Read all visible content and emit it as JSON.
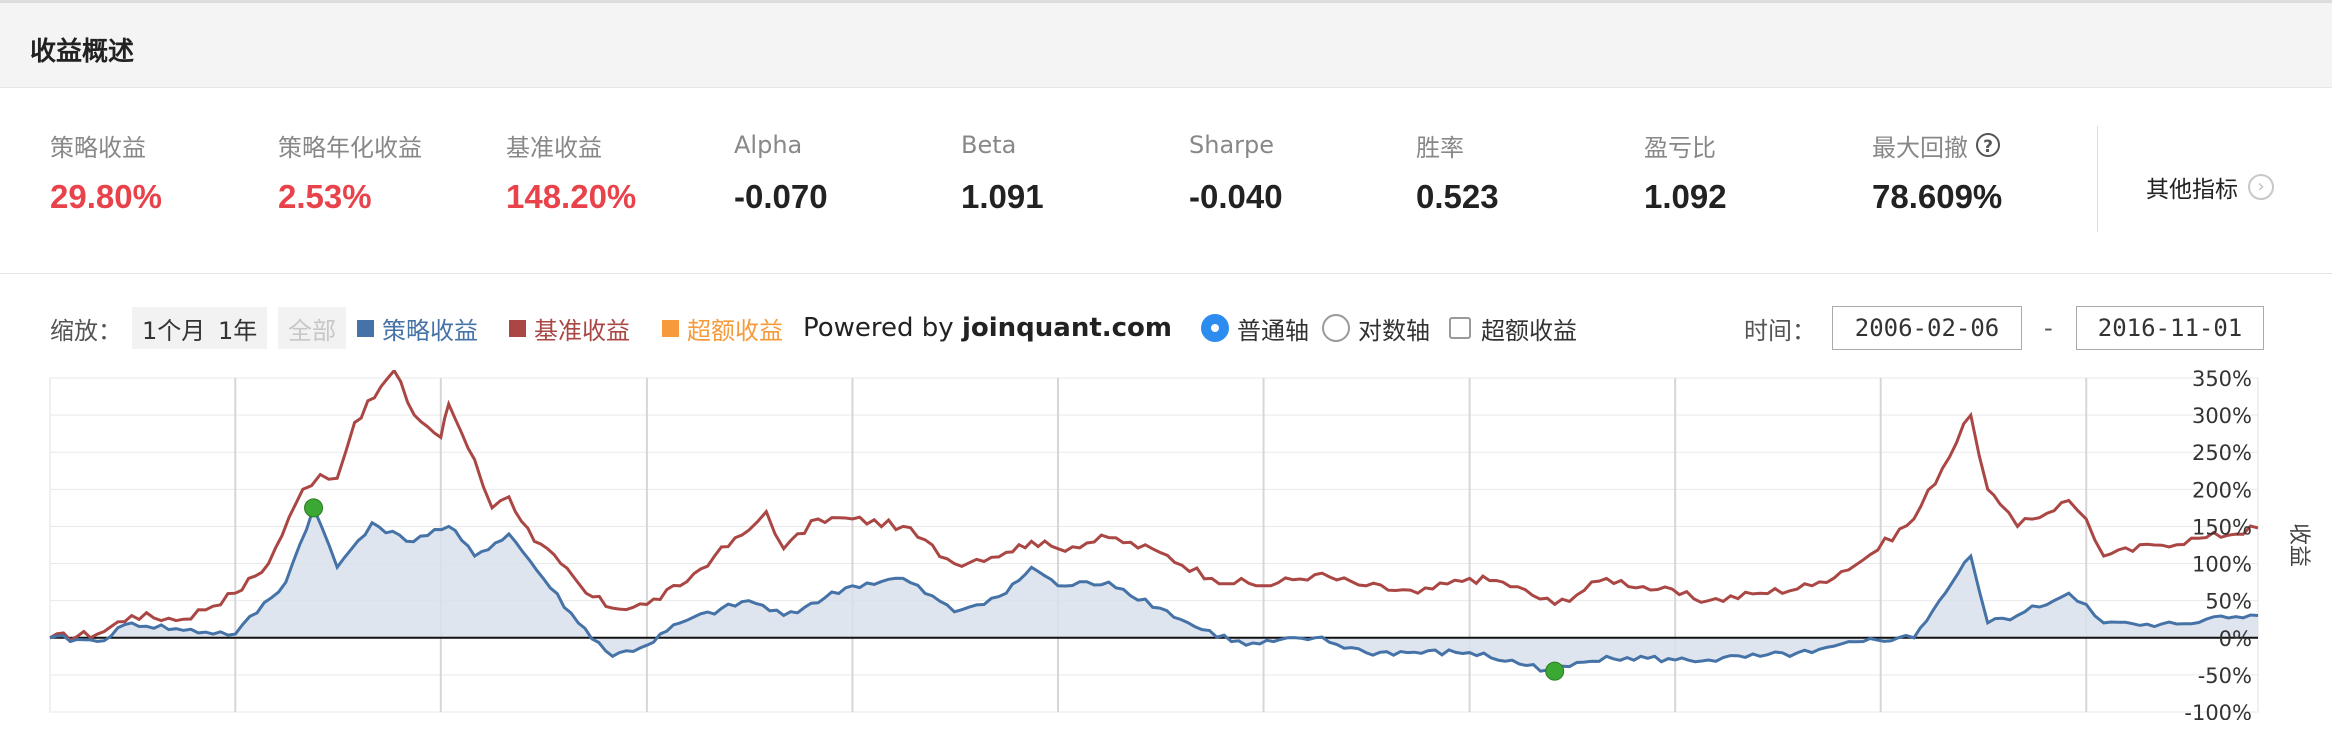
{
  "header": {
    "title": "收益概述"
  },
  "metrics": [
    {
      "label": "策略收益",
      "value": "29.80%",
      "tone": "red"
    },
    {
      "label": "策略年化收益",
      "value": "2.53%",
      "tone": "red"
    },
    {
      "label": "基准收益",
      "value": "148.20%",
      "tone": "red"
    },
    {
      "label": "Alpha",
      "value": "-0.070",
      "tone": "dark"
    },
    {
      "label": "Beta",
      "value": "1.091",
      "tone": "dark"
    },
    {
      "label": "Sharpe",
      "value": "-0.040",
      "tone": "dark"
    },
    {
      "label": "胜率",
      "value": "0.523",
      "tone": "dark"
    },
    {
      "label": "盈亏比",
      "value": "1.092",
      "tone": "dark"
    },
    {
      "label": "最大回撤",
      "value": "78.609%",
      "tone": "dark",
      "help_icon": "question-circle-icon"
    }
  ],
  "other_metrics": {
    "label": "其他指标",
    "icon": "chevron-right-circle-icon"
  },
  "toolbar": {
    "zoom_label": "缩放：",
    "zoom_buttons": [
      "1个月",
      "1年",
      "全部"
    ],
    "legend": [
      {
        "label": "策略收益",
        "color": "#4572a7"
      },
      {
        "label": "基准收益",
        "color": "#aa4643"
      },
      {
        "label": "超额收益",
        "color": "#f79a3b"
      }
    ],
    "powered_prefix": "Powered by ",
    "powered_brand": "joinquant.com",
    "axis_options": {
      "normal": "普通轴",
      "log": "对数轴",
      "selected": "normal"
    },
    "excess_toggle": "超额收益",
    "time_label": "时间：",
    "date_from": "2006-02-06",
    "date_sep": "-",
    "date_to": "2016-11-01"
  },
  "chart_data": {
    "type": "line",
    "y_axis_title": "收益",
    "ylim": [
      -100,
      350
    ],
    "y_ticks": [
      "350%",
      "300%",
      "250%",
      "200%",
      "150%",
      "100%",
      "50%",
      "0%",
      "-50%",
      "-100%"
    ],
    "y_tick_values": [
      350,
      300,
      250,
      200,
      150,
      100,
      50,
      0,
      -50,
      -100
    ],
    "x_range": [
      "2006-02-06",
      "2016-11-01"
    ],
    "x_gridline_dates": [
      "2007-01-01",
      "2008-01-01",
      "2009-01-01",
      "2010-01-01",
      "2011-01-01",
      "2012-01-01",
      "2013-01-01",
      "2014-01-01",
      "2015-01-01",
      "2016-01-01"
    ],
    "grid": true,
    "series": [
      {
        "name": "基准收益",
        "color": "#aa4643",
        "points": [
          [
            "2006-02-06",
            0
          ],
          [
            "2006-05-01",
            5
          ],
          [
            "2006-07-01",
            30
          ],
          [
            "2006-10-01",
            25
          ],
          [
            "2007-01-01",
            60
          ],
          [
            "2007-03-01",
            100
          ],
          [
            "2007-05-01",
            200
          ],
          [
            "2007-06-01",
            220
          ],
          [
            "2007-07-01",
            215
          ],
          [
            "2007-08-01",
            290
          ],
          [
            "2007-10-10",
            360
          ],
          [
            "2007-11-15",
            300
          ],
          [
            "2008-01-01",
            270
          ],
          [
            "2008-01-15",
            315
          ],
          [
            "2008-03-01",
            240
          ],
          [
            "2008-04-01",
            175
          ],
          [
            "2008-05-01",
            190
          ],
          [
            "2008-06-15",
            130
          ],
          [
            "2008-08-01",
            100
          ],
          [
            "2008-09-15",
            60
          ],
          [
            "2008-11-01",
            40
          ],
          [
            "2009-01-01",
            45
          ],
          [
            "2009-03-01",
            70
          ],
          [
            "2009-05-01",
            110
          ],
          [
            "2009-07-01",
            145
          ],
          [
            "2009-08-01",
            170
          ],
          [
            "2009-09-01",
            120
          ],
          [
            "2009-11-01",
            160
          ],
          [
            "2010-01-01",
            160
          ],
          [
            "2010-04-01",
            150
          ],
          [
            "2010-07-01",
            100
          ],
          [
            "2010-10-01",
            115
          ],
          [
            "2010-11-15",
            130
          ],
          [
            "2011-01-01",
            120
          ],
          [
            "2011-04-01",
            135
          ],
          [
            "2011-07-01",
            115
          ],
          [
            "2011-10-01",
            80
          ],
          [
            "2012-01-01",
            70
          ],
          [
            "2012-04-01",
            85
          ],
          [
            "2012-07-01",
            70
          ],
          [
            "2012-10-01",
            60
          ],
          [
            "2013-01-01",
            80
          ],
          [
            "2013-03-01",
            75
          ],
          [
            "2013-06-01",
            45
          ],
          [
            "2013-09-01",
            80
          ],
          [
            "2013-12-01",
            65
          ],
          [
            "2014-03-01",
            50
          ],
          [
            "2014-06-01",
            60
          ],
          [
            "2014-09-01",
            70
          ],
          [
            "2014-12-01",
            105
          ],
          [
            "2015-03-01",
            160
          ],
          [
            "2015-06-10",
            300
          ],
          [
            "2015-07-10",
            200
          ],
          [
            "2015-08-01",
            180
          ],
          [
            "2015-09-01",
            150
          ],
          [
            "2015-12-01",
            185
          ],
          [
            "2016-01-01",
            160
          ],
          [
            "2016-02-01",
            110
          ],
          [
            "2016-05-01",
            125
          ],
          [
            "2016-08-01",
            135
          ],
          [
            "2016-11-01",
            148
          ]
        ]
      },
      {
        "name": "策略收益",
        "color": "#4572a7",
        "fill": "#d9e1ec",
        "points": [
          [
            "2006-02-06",
            0
          ],
          [
            "2006-05-01",
            -5
          ],
          [
            "2006-07-01",
            20
          ],
          [
            "2006-10-01",
            10
          ],
          [
            "2007-01-01",
            5
          ],
          [
            "2007-04-01",
            75
          ],
          [
            "2007-05-20",
            175
          ],
          [
            "2007-07-01",
            95
          ],
          [
            "2007-09-01",
            155
          ],
          [
            "2007-11-01",
            130
          ],
          [
            "2008-01-15",
            150
          ],
          [
            "2008-03-01",
            110
          ],
          [
            "2008-05-01",
            140
          ],
          [
            "2008-07-01",
            80
          ],
          [
            "2008-09-01",
            20
          ],
          [
            "2008-11-01",
            -25
          ],
          [
            "2009-01-01",
            -10
          ],
          [
            "2009-03-01",
            20
          ],
          [
            "2009-07-01",
            50
          ],
          [
            "2009-09-01",
            30
          ],
          [
            "2010-01-01",
            70
          ],
          [
            "2010-04-01",
            80
          ],
          [
            "2010-07-01",
            35
          ],
          [
            "2010-10-01",
            60
          ],
          [
            "2010-11-15",
            95
          ],
          [
            "2011-01-01",
            70
          ],
          [
            "2011-04-01",
            75
          ],
          [
            "2011-07-01",
            40
          ],
          [
            "2011-09-01",
            15
          ],
          [
            "2011-12-01",
            -10
          ],
          [
            "2012-04-01",
            0
          ],
          [
            "2012-07-01",
            -20
          ],
          [
            "2013-01-01",
            -20
          ],
          [
            "2013-06-01",
            -45
          ],
          [
            "2013-09-01",
            -25
          ],
          [
            "2014-01-01",
            -30
          ],
          [
            "2014-03-01",
            -30
          ],
          [
            "2014-06-01",
            -25
          ],
          [
            "2014-09-01",
            -20
          ],
          [
            "2014-12-01",
            -5
          ],
          [
            "2015-02-01",
            0
          ],
          [
            "2015-03-01",
            0
          ],
          [
            "2015-04-15",
            50
          ],
          [
            "2015-06-10",
            110
          ],
          [
            "2015-07-10",
            20
          ],
          [
            "2015-09-01",
            30
          ],
          [
            "2015-12-01",
            60
          ],
          [
            "2016-01-01",
            45
          ],
          [
            "2016-02-01",
            20
          ],
          [
            "2016-05-01",
            15
          ],
          [
            "2016-08-01",
            25
          ],
          [
            "2016-11-01",
            30
          ]
        ]
      }
    ],
    "markers": [
      {
        "date": "2007-05-20",
        "value": 175,
        "color": "#3aa832"
      },
      {
        "date": "2013-06-01",
        "value": -45,
        "color": "#3aa832"
      }
    ]
  }
}
